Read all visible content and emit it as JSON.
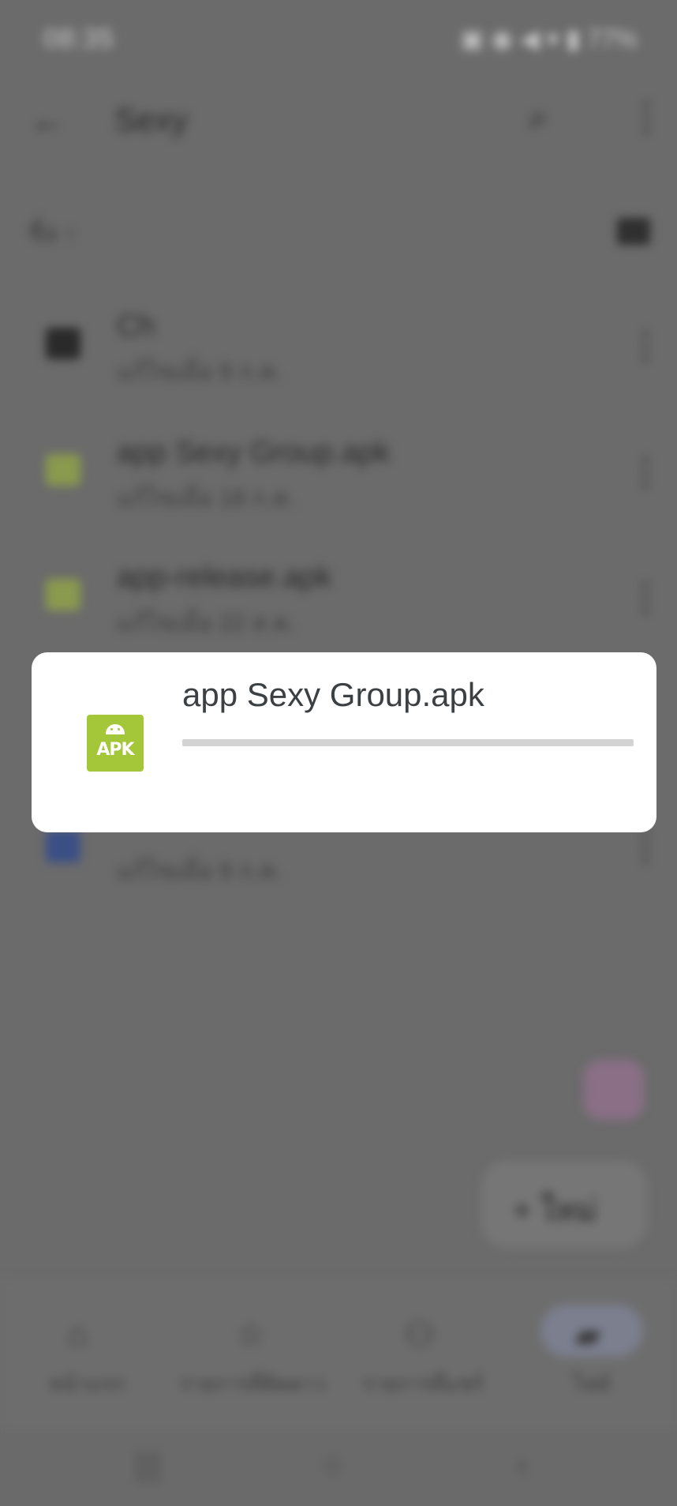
{
  "status_bar": {
    "time": "08:35",
    "right_indicators": "▣ ◉ ◀ ▾ ▮ 77%"
  },
  "app_bar": {
    "title": "Sexy"
  },
  "sort": {
    "label": "ชื่อ ↑"
  },
  "files": [
    {
      "name": "Ch",
      "meta": "แก้ไขเมื่อ 9 ก.ค.",
      "type": "folder"
    },
    {
      "name": "app Sexy Group.apk",
      "meta": "แก้ไขเมื่อ 18 ก.ค.",
      "type": "apk"
    },
    {
      "name": "app-release.apk",
      "meta": "แก้ไขเมื่อ 22 ส.ค.",
      "type": "apk"
    },
    {
      "name": "",
      "meta": "แก้ไขเมื่อ 9 ก.ค.",
      "type": "doc"
    }
  ],
  "fab": {
    "new_label": "ใหม่"
  },
  "bottom_nav": [
    {
      "label": "หน้าแรก",
      "icon": "home-icon"
    },
    {
      "label": "รายการที่ติดดาว",
      "icon": "star-icon"
    },
    {
      "label": "รายการที่แชร์",
      "icon": "people-icon"
    },
    {
      "label": "ไฟล์",
      "icon": "folder-icon"
    }
  ],
  "dialog": {
    "filename": "app Sexy Group.apk",
    "icon_text": "APK",
    "progress": 0.0
  },
  "colors": {
    "apk_green": "#a4c639",
    "dialog_bg": "#ffffff",
    "track": "#d3d3d3"
  }
}
